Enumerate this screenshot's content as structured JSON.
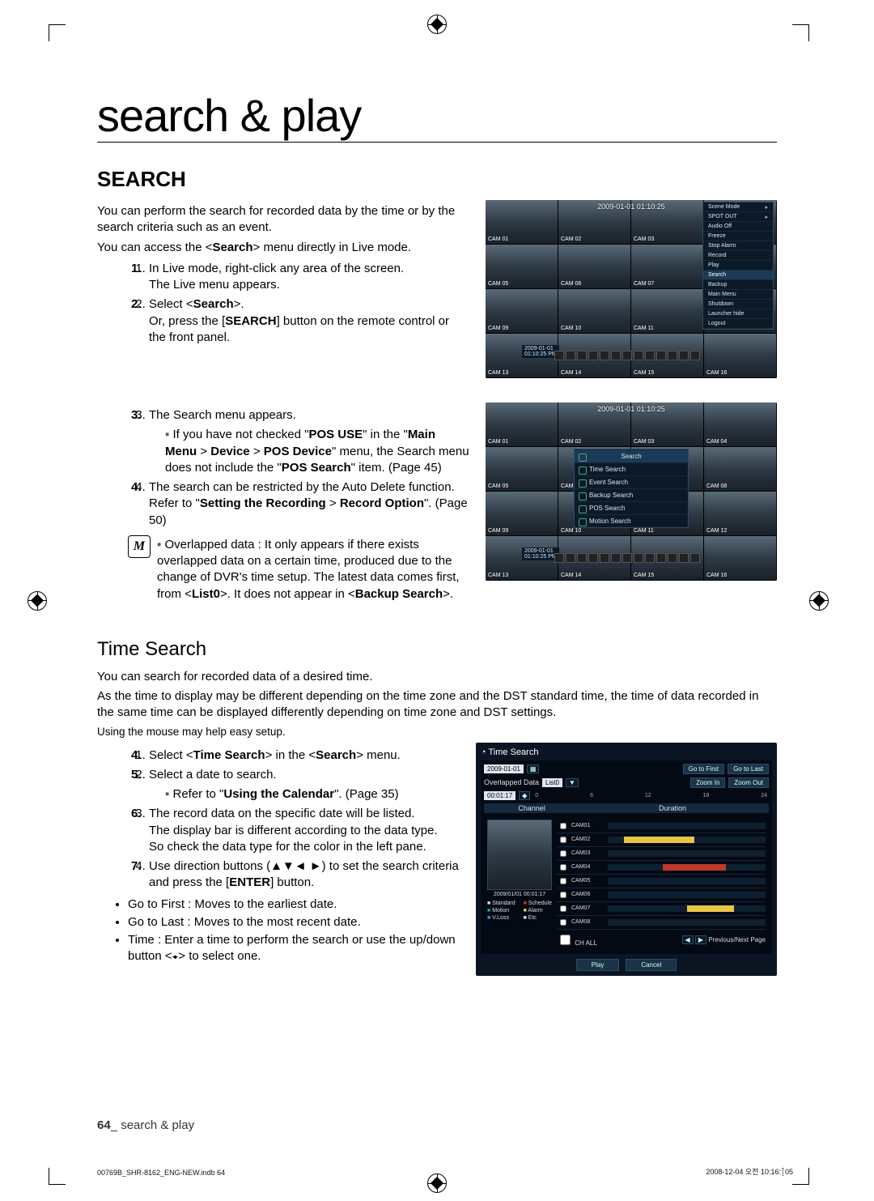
{
  "page": {
    "title": "search & play",
    "section": "SEARCH",
    "intro1": "You can perform the search for recorded data by the time or by the search criteria such as an event.",
    "intro2_pre": "You can access the <",
    "intro2_bold": "Search",
    "intro2_post": "> menu directly in Live mode.",
    "step1a": "In Live mode, right-click any area of the screen.",
    "step1b": "The Live menu appears.",
    "step2a_pre": "Select <",
    "step2a_bold": "Search",
    "step2a_post": ">.",
    "step2b_pre": "Or, press the [",
    "step2b_bold": "SEARCH",
    "step2b_post": "] button on the remote control or the front panel.",
    "step3": "The Search menu appears.",
    "step3_sub_pre": "If you have not checked \"",
    "step3_sub_b1": "POS USE",
    "step3_sub_m1": "\" in the \"",
    "step3_sub_b2": "Main Menu",
    "step3_sub_m2": " > ",
    "step3_sub_b3": "Device",
    "step3_sub_m3": " > ",
    "step3_sub_b4": "POS Device",
    "step3_sub_m4": "\" menu, the Search menu does not include the \"",
    "step3_sub_b5": "POS Search",
    "step3_sub_post": "\" item. (Page 45)",
    "step4a": "The search can be restricted by the Auto Delete function.",
    "step4b_pre": "Refer to \"",
    "step4b_b1": "Setting the Recording",
    "step4b_m1": " > ",
    "step4b_b2": "Record Option",
    "step4b_post": "\". (Page 50)",
    "note_pre": "Overlapped data : It only appears if there exists overlapped data on a certain time, produced due to the change of DVR's time setup. The latest data comes first, from <",
    "note_b1": "List0",
    "note_m1": ">. It does not appear in <",
    "note_b2": "Backup Search",
    "note_post": ">.",
    "ts_title": "Time Search",
    "ts_p1": "You can search for recorded data of a desired time.",
    "ts_p2": "As the time to display may be different depending on the time zone and the DST standard time, the time of data recorded in the same time can be displayed differently depending on time zone and DST settings.",
    "ts_p3": "Using the mouse may help easy setup.",
    "ts_step4_pre": "Select <",
    "ts_step4_b1": "Time Search",
    "ts_step4_m1": "> in the <",
    "ts_step4_b2": "Search",
    "ts_step4_post": "> menu.",
    "ts_step5": "Select a date to search.",
    "ts_step5_sub_pre": "Refer to \"",
    "ts_step5_sub_b": "Using the Calendar",
    "ts_step5_sub_post": "\". (Page 35)",
    "ts_step6a": "The record data on the specific date will be listed.",
    "ts_step6b": "The display bar is different according to the data type.",
    "ts_step6c": "So check the data type for the color in the left pane.",
    "ts_step7_pre": "Use direction buttons (▲▼◄ ►) to set the search criteria and press the [",
    "ts_step7_b": "ENTER",
    "ts_step7_post": "] button.",
    "ts_b1": "Go to First : Moves to the earliest date.",
    "ts_b2": "Go to Last : Moves to the most recent date.",
    "ts_b3_pre": "Time : Enter a time to perform the search or use the up/down button <",
    "ts_b3_sym": "▲▼",
    "ts_b3_post": "> to select one.",
    "footer_page": "64",
    "footer_text": "_ search & play",
    "indb": "00769B_SHR-8162_ENG-NEW.indb   64",
    "printts": "2008-12-04   오전 10:16:05",
    "printtsA": "2008-12-04   오전 10:16:",
    "printtsB": "05"
  },
  "ctx_menu": {
    "items": [
      "Scene Mode",
      "SPOT OUT",
      "Audio Off",
      "Freeze",
      "Stop Alarm",
      "Record",
      "Play",
      "Search",
      "Backup",
      "Main Menu",
      "Shutdown",
      "Launcher hide",
      "Logout"
    ]
  },
  "search_menu": {
    "header": "Search",
    "items": [
      "Time Search",
      "Event Search",
      "Backup Search",
      "POS Search",
      "Motion Search"
    ]
  },
  "dvr": {
    "timestamp": "2009-01-01 01:10:25",
    "cams": [
      "CAM 01",
      "CAM 02",
      "CAM 03",
      "CAM 04",
      "CAM 05",
      "CAM 06",
      "CAM 07",
      "CAM 08",
      "CAM 09",
      "CAM 10",
      "CAM 11",
      "CAM 12",
      "CAM 13",
      "CAM 14",
      "CAM 15",
      "CAM 16"
    ],
    "bottom_ts_a": "2009-01-01",
    "bottom_ts_b": "01:10:25 PM"
  },
  "panel": {
    "title": "Time Search",
    "date": "2009-01-01",
    "go_first": "Go to First",
    "go_last": "Go to Last",
    "overlap_lbl": "Overlapped Data",
    "overlap_val": "List0",
    "zoom_in": "Zoom In",
    "zoom_out": "Zoom Out",
    "time_field": "00:01:17",
    "ticks": [
      "0",
      "6",
      "12",
      "18",
      "24"
    ],
    "col_channel": "Channel",
    "col_duration": "Duration",
    "preview_ts": "2009/01/01 00:01:17",
    "legend": [
      "Standard",
      "Schedule",
      "Motion",
      "Alarm",
      "V.Loss",
      "Etc"
    ],
    "ch_all": "CH ALL",
    "nav": "Previous/Next Page",
    "play": "Play",
    "cancel": "Cancel",
    "channels": [
      "CAM01",
      "CAM02",
      "CAM03",
      "CAM04",
      "CAM05",
      "CAM06",
      "CAM07",
      "CAM08"
    ]
  }
}
